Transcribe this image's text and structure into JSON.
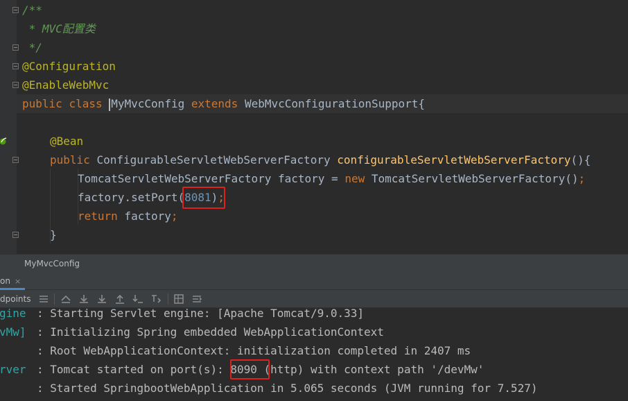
{
  "editor": {
    "lines": {
      "l1": "/**",
      "l2": " * MVC配置类",
      "l3": " */",
      "l4": "@Configuration",
      "l5": "@EnableWebMvc",
      "l6": {
        "kw_public": "public",
        "kw_class": "class",
        "class_name": "MyMvcConfig",
        "kw_extends": "extends",
        "superclass": "WebMvcConfigurationSupport{"
      },
      "l8": "@Bean",
      "l9": {
        "kw_public": "public",
        "return_type": "ConfigurableServletWebServerFactory",
        "method_name": "configurableServletWebServerFactory",
        "tail": "(){"
      },
      "l10": {
        "type": "TomcatServletWebServerFactory factory = ",
        "kw_new": "new",
        "ctor": " TomcatServletWebServerFactory()",
        "semi": ";"
      },
      "l11": {
        "call": "factory.setPort",
        "open": "(",
        "port": "8081",
        "close": ")",
        "semi": ";"
      },
      "l12": {
        "kw_return": "return",
        "expr": " factory",
        "semi": ";"
      },
      "l13": "}"
    }
  },
  "breadcrumb": {
    "item": "MyMvcConfig"
  },
  "tool_window": {
    "tab_label": "on",
    "tab_close": "×",
    "toolbar_label": "dpoints"
  },
  "console": {
    "lines": [
      {
        "source": "gine",
        "message": ": Starting Servlet engine: [Apache Tomcat/9.0.33]"
      },
      {
        "source": "vMw]",
        "message": ": Initializing Spring embedded WebApplicationContext"
      },
      {
        "source": "",
        "message": ": Root WebApplicationContext: initialization completed in 2407 ms"
      },
      {
        "source": "rver",
        "message_before": ": Tomcat started on port(s): ",
        "port": "8090",
        "message_after": " (http) with context path '/devMw'"
      },
      {
        "source": "",
        "message": ": Started SpringbootWebApplication in 5.065 seconds (JVM running for 7.527)"
      }
    ]
  },
  "colors": {
    "highlight_box": "#e0201b",
    "comment": "#629755",
    "annotation": "#bbb529",
    "keyword": "#cc7832",
    "method": "#ffc66d",
    "number": "#6897bb"
  }
}
